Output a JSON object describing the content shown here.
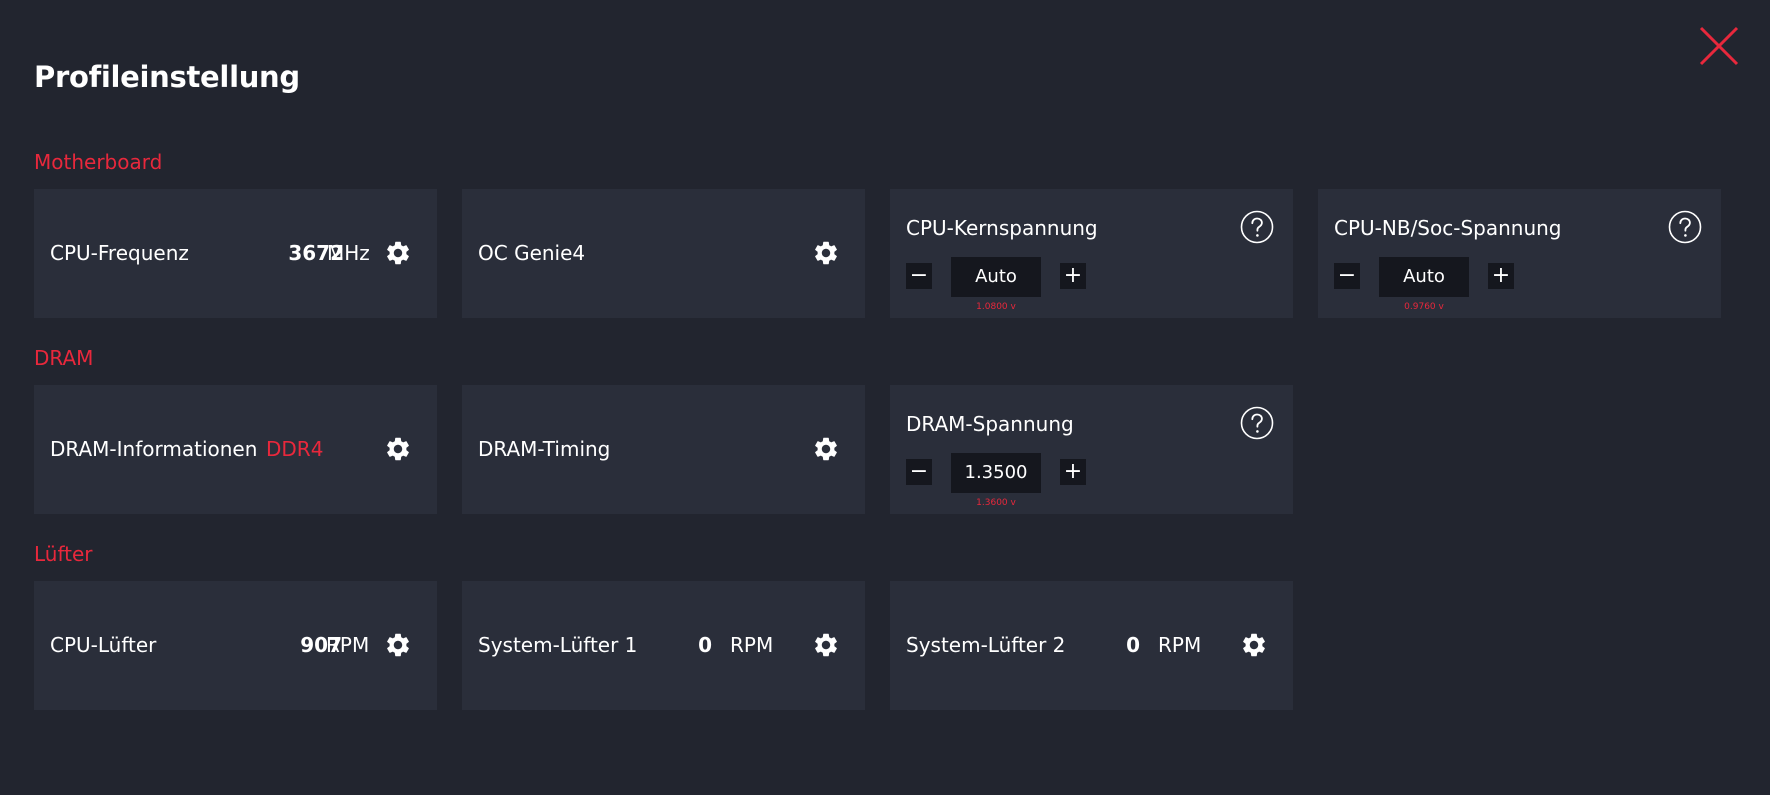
{
  "page": {
    "title": "Profileinstellung"
  },
  "colors": {
    "background": "#22252f",
    "card": "#2a2e3a",
    "accent": "#e8283c",
    "input": "#15171e"
  },
  "icons": {
    "close": "close-icon",
    "settings": "gear-icon",
    "help": "question-circle-icon",
    "decrease": "minus-icon",
    "increase": "plus-icon"
  },
  "motherboard": {
    "title": "Motherboard",
    "cpu_freq": {
      "label": "CPU-Frequenz",
      "value": "3672",
      "unit": "MHz"
    },
    "oc_genie": {
      "label": "OC Genie4"
    },
    "cpu_core_voltage": {
      "label": "CPU-Kernspannung",
      "minus": "−",
      "value": "Auto",
      "plus": "+",
      "current": "1.0800 v"
    },
    "cpu_nb_voltage": {
      "label": "CPU-NB/Soc-Spannung",
      "minus": "−",
      "value": "Auto",
      "plus": "+",
      "current": "0.9760 v"
    }
  },
  "dram": {
    "title": "DRAM",
    "info": {
      "label": "DRAM-Informationen",
      "value": "DDR4"
    },
    "timing": {
      "label": "DRAM-Timing"
    },
    "voltage": {
      "label": "DRAM-Spannung",
      "minus": "−",
      "value": "1.3500",
      "plus": "+",
      "current": "1.3600 v"
    }
  },
  "fans": {
    "title": "Lüfter",
    "cpu_fan": {
      "label": "CPU-Lüfter",
      "value": "907",
      "unit": "RPM"
    },
    "sys_fan1": {
      "label": "System-Lüfter 1",
      "value": "0",
      "unit": "RPM"
    },
    "sys_fan2": {
      "label": "System-Lüfter 2",
      "value": "0",
      "unit": "RPM"
    }
  }
}
